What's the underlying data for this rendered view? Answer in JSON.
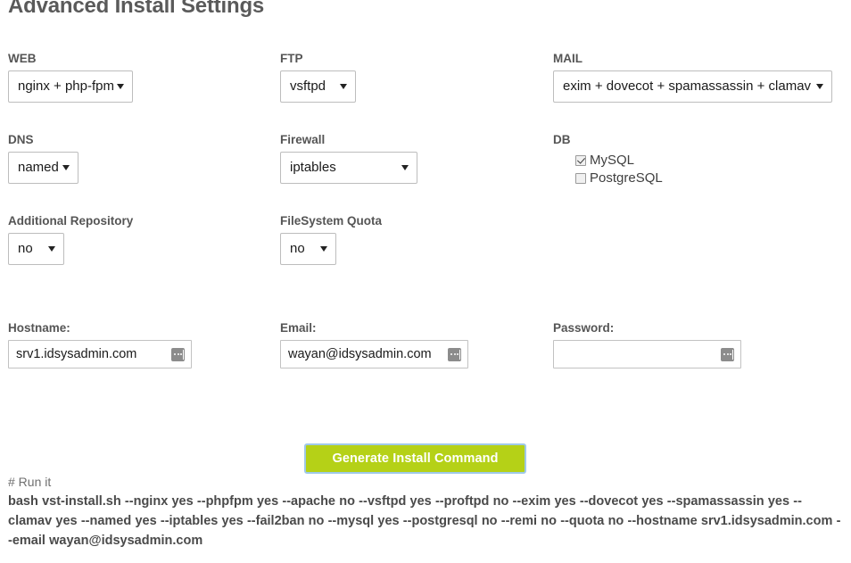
{
  "page_title": "Advanced Install Settings",
  "fields": {
    "web": {
      "label": "WEB",
      "value": "nginx + php-fpm"
    },
    "ftp": {
      "label": "FTP",
      "value": "vsftpd"
    },
    "mail": {
      "label": "MAIL",
      "value": "exim + dovecot + spamassassin + clamav"
    },
    "dns": {
      "label": "DNS",
      "value": "named"
    },
    "firewall": {
      "label": "Firewall",
      "value": "iptables"
    },
    "db": {
      "label": "DB"
    },
    "additional_repository": {
      "label": "Additional Repository",
      "value": "no"
    },
    "filesystem_quota": {
      "label": "FileSystem Quota",
      "value": "no"
    }
  },
  "db_options": [
    {
      "label": "MySQL",
      "checked": true
    },
    {
      "label": "PostgreSQL",
      "checked": false
    }
  ],
  "inputs": {
    "hostname": {
      "label": "Hostname:",
      "value": "srv1.idsysadmin.com"
    },
    "email": {
      "label": "Email:",
      "value": "wayan@idsysadmin.com"
    },
    "password": {
      "label": "Password:",
      "value": ""
    }
  },
  "generate_button": {
    "label": "Generate Install Command"
  },
  "output": {
    "comment": "# Run it",
    "command": "bash vst-install.sh --nginx yes --phpfpm yes --apache no --vsftpd yes --proftpd no --exim yes --dovecot yes --spamassassin yes --clamav yes --named yes --iptables yes --fail2ban no --mysql yes --postgresql no --remi no --quota no --hostname srv1.idsysadmin.com --email wayan@idsysadmin.com"
  },
  "colors": {
    "button_bg": "#b5d117",
    "button_border": "#9fc9e8",
    "text": "#4d4d4d"
  },
  "icons": {
    "autofill": "autofill-icon",
    "dropdown": "chevron-down-icon"
  }
}
